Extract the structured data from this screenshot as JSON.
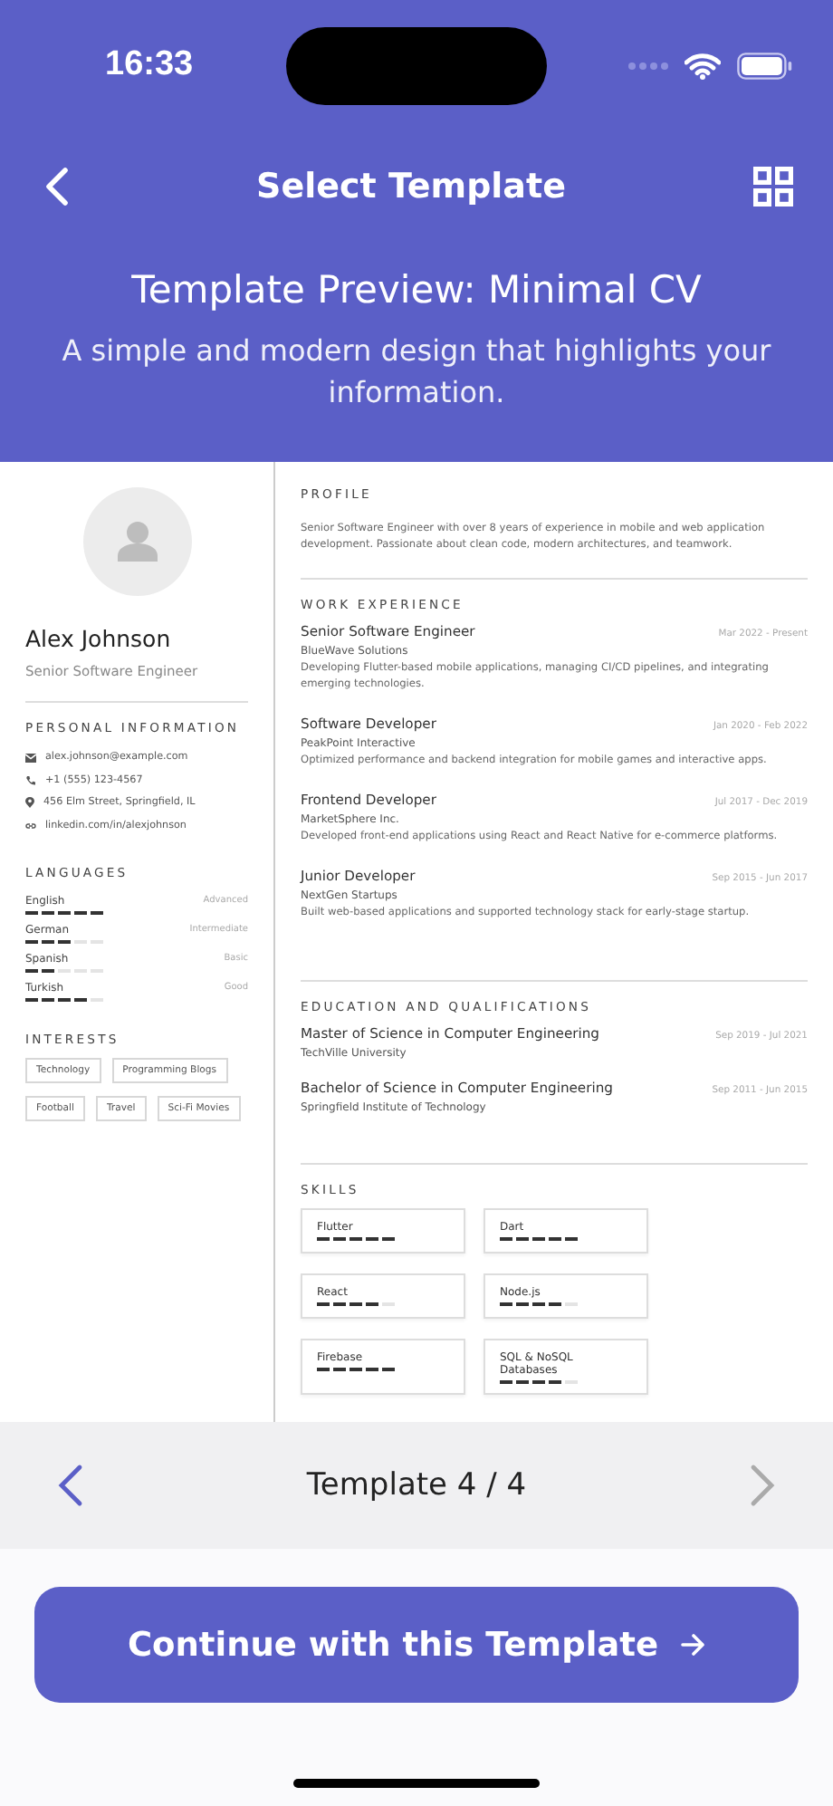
{
  "status_bar": {
    "time": "16:33"
  },
  "header": {
    "title": "Select Template"
  },
  "preview": {
    "title": "Template Preview: Minimal CV",
    "subtitle": "A simple and modern design that highlights your information."
  },
  "cv": {
    "name": "Alex Johnson",
    "role": "Senior Software Engineer",
    "personal_information": {
      "heading": "PERSONAL INFORMATION",
      "items": [
        {
          "kind": "email",
          "text": "alex.johnson@example.com"
        },
        {
          "kind": "phone",
          "text": "+1 (555) 123-4567"
        },
        {
          "kind": "location",
          "text": "456 Elm Street, Springfield, IL"
        },
        {
          "kind": "link",
          "text": "linkedin.com/in/alexjohnson"
        }
      ]
    },
    "languages": {
      "heading": "LANGUAGES",
      "items": [
        {
          "name": "English",
          "level_text": "Advanced",
          "stars": 5
        },
        {
          "name": "German",
          "level_text": "Intermediate",
          "stars": 3
        },
        {
          "name": "Spanish",
          "level_text": "Basic",
          "stars": 2
        },
        {
          "name": "Turkish",
          "level_text": "Good",
          "stars": 4
        }
      ]
    },
    "interests": {
      "heading": "INTERESTS",
      "items": [
        "Technology",
        "Programming Blogs",
        "Football",
        "Travel",
        "Sci-Fi Movies"
      ]
    },
    "profile": {
      "heading": "PROFILE",
      "text": "Senior Software Engineer with over 8 years of experience in mobile and web application development. Passionate about clean code, modern architectures, and teamwork."
    },
    "work_experience": {
      "heading": "WORK EXPERIENCE",
      "items": [
        {
          "title": "Senior Software Engineer",
          "company": "BlueWave Solutions",
          "dates": "Mar 2022 - Present",
          "description": "Developing Flutter-based mobile applications, managing CI/CD pipelines, and integrating emerging technologies."
        },
        {
          "title": "Software Developer",
          "company": "PeakPoint Interactive",
          "dates": "Jan 2020 - Feb 2022",
          "description": "Optimized performance and backend integration for mobile games and interactive apps."
        },
        {
          "title": "Frontend Developer",
          "company": "MarketSphere Inc.",
          "dates": "Jul 2017 - Dec 2019",
          "description": "Developed front-end applications using React and React Native for e-commerce platforms."
        },
        {
          "title": "Junior Developer",
          "company": "NextGen Startups",
          "dates": "Sep 2015 - Jun 2017",
          "description": "Built web-based applications and supported technology stack for early-stage startup."
        }
      ]
    },
    "education": {
      "heading": "EDUCATION AND QUALIFICATIONS",
      "items": [
        {
          "degree": "Master of Science in Computer Engineering",
          "school": "TechVille University",
          "dates": "Sep 2019 - Jul 2021"
        },
        {
          "degree": "Bachelor of Science in Computer Engineering",
          "school": "Springfield Institute of Technology",
          "dates": "Sep 2011 - Jun 2015"
        }
      ]
    },
    "skills": {
      "heading": "SKILLS",
      "items": [
        {
          "name": "Flutter",
          "stars": 5
        },
        {
          "name": "Dart",
          "stars": 5
        },
        {
          "name": "React",
          "stars": 4
        },
        {
          "name": "Node.js",
          "stars": 4
        },
        {
          "name": "Firebase",
          "stars": 5
        },
        {
          "name": "SQL & NoSQL Databases",
          "stars": 4
        }
      ]
    }
  },
  "pager": {
    "label": "Template 4 / 4",
    "previous": {
      "disabled": false
    },
    "next": {
      "disabled": true
    }
  },
  "continue_button": {
    "label": "Continue with this Template"
  }
}
